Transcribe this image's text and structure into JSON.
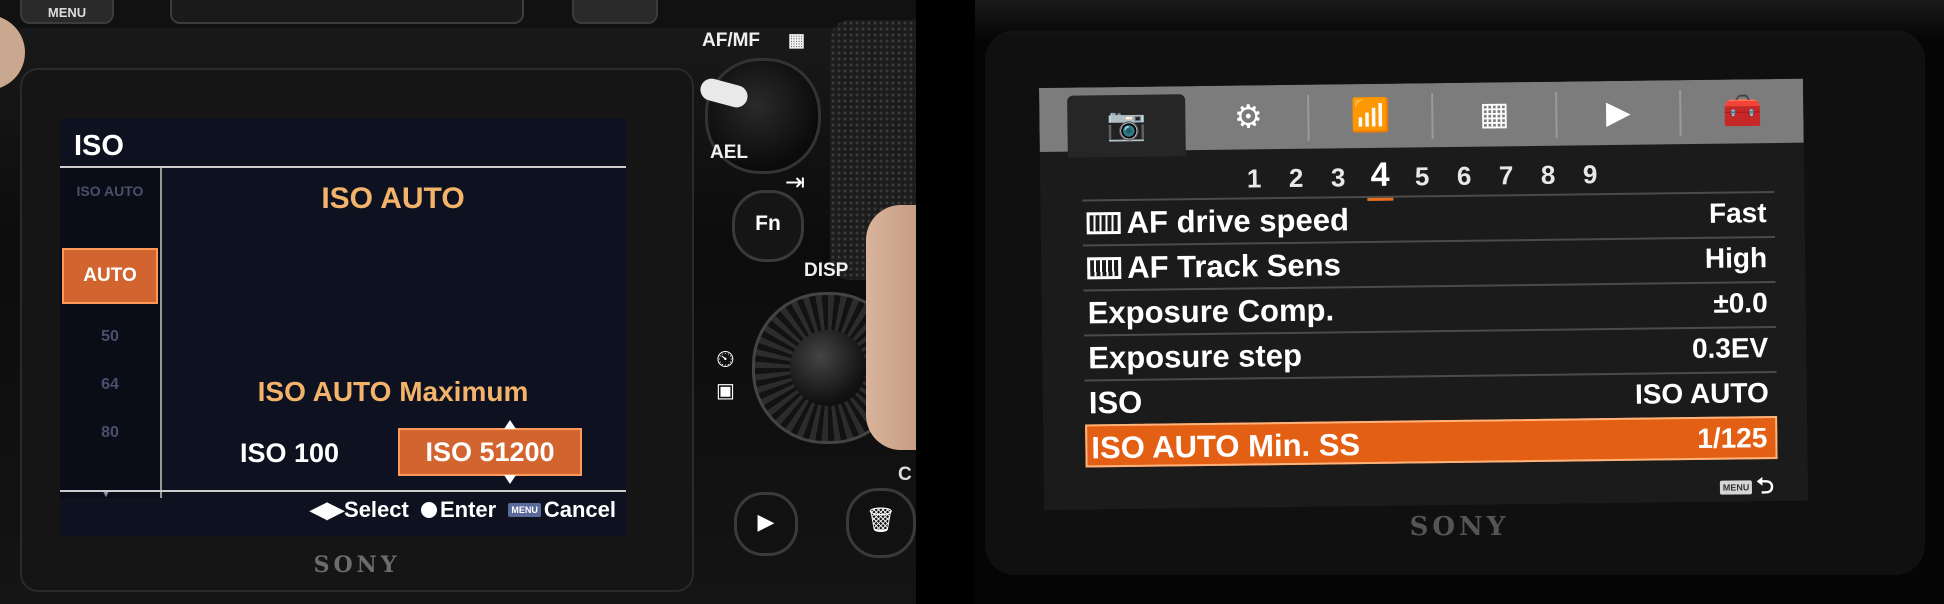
{
  "left_camera": {
    "top_buttons": {
      "menu_label": "MENU"
    },
    "labels": {
      "afmf": "AF/MF",
      "ael": "AEL",
      "fn": "Fn",
      "disp": "DISP",
      "c": "C"
    },
    "brand": "SONY",
    "lcd": {
      "title": "ISO",
      "iso_column": [
        {
          "label": "ISO AUTO",
          "selected": false
        },
        {
          "label": "AUTO",
          "selected": true
        },
        {
          "label": "50",
          "selected": false
        },
        {
          "label": "64",
          "selected": false
        },
        {
          "label": "80",
          "selected": false
        }
      ],
      "heading": "ISO AUTO",
      "max_heading": "ISO AUTO Maximum",
      "min_value": "ISO 100",
      "max_value": "ISO 51200",
      "guide": {
        "select": "Select",
        "enter": "Enter",
        "menu_icon": "MENU",
        "cancel": "Cancel"
      }
    },
    "icons": [
      "enter-icon",
      "self-timer-icon",
      "play-icon",
      "trash-icon"
    ],
    "accent_color": "#d2642f"
  },
  "right_camera": {
    "brand": "SONY",
    "tabs": [
      {
        "icon": "camera-icon",
        "glyph": "📷",
        "active": true
      },
      {
        "icon": "gear-icon",
        "glyph": "⚙",
        "active": false
      },
      {
        "icon": "wireless-icon",
        "glyph": "📶",
        "active": false
      },
      {
        "icon": "apps-icon",
        "glyph": "▦",
        "active": false
      },
      {
        "icon": "playback-icon",
        "glyph": "▶",
        "active": false
      },
      {
        "icon": "toolbox-icon",
        "glyph": "🧰",
        "active": false
      }
    ],
    "pages": [
      "1",
      "2",
      "3",
      "4",
      "5",
      "6",
      "7",
      "8",
      "9"
    ],
    "active_page": "4",
    "menu_items": [
      {
        "label": "AF drive speed",
        "value": "Fast",
        "film_icon": true,
        "selected": false
      },
      {
        "label": "AF Track Sens",
        "value": "High",
        "film_icon": true,
        "selected": false
      },
      {
        "label": "Exposure Comp.",
        "value": "±0.0",
        "film_icon": false,
        "selected": false
      },
      {
        "label": "Exposure step",
        "value": "0.3EV",
        "film_icon": false,
        "selected": false
      },
      {
        "label": "ISO",
        "value": "ISO AUTO",
        "film_icon": false,
        "selected": false
      },
      {
        "label": "ISO AUTO Min. SS",
        "value": "1/125",
        "film_icon": false,
        "selected": true
      }
    ],
    "back_hint": {
      "menu_icon": "MENU",
      "back_glyph": "⮌"
    },
    "accent_color": "#e35f14"
  }
}
